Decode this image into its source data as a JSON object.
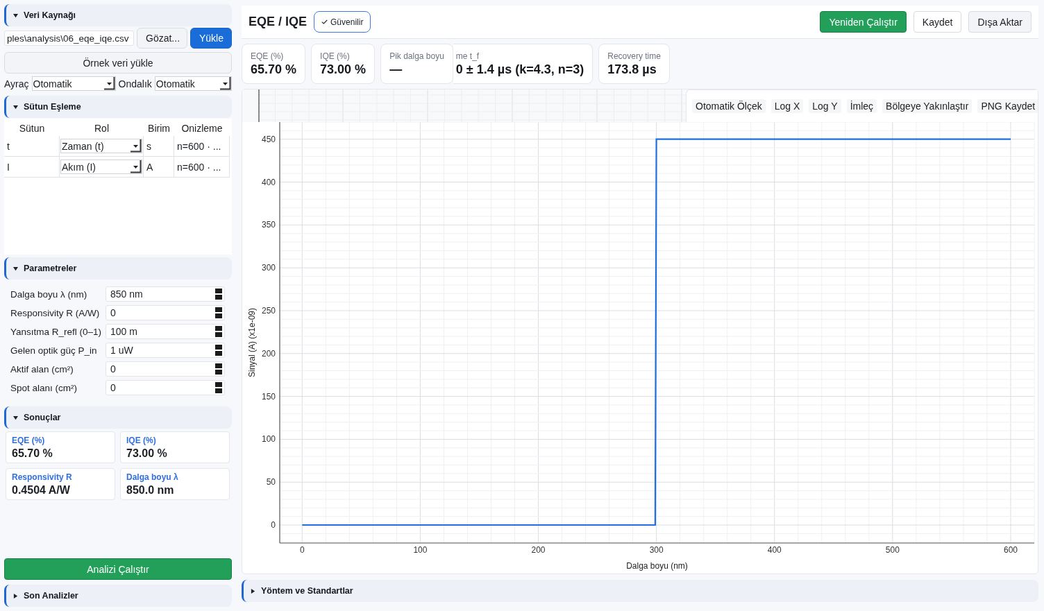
{
  "sidebar": {
    "data_source": {
      "title": "Veri Kaynağı",
      "expanded": true,
      "file_path": "ples\\analysis\\06_eqe_iqe.csv",
      "browse_button": "Gözat...",
      "load_button": "Yükle",
      "sample_button": "Örnek veri yükle",
      "delimiter": {
        "label": "Ayraç",
        "value": "Otomatik"
      },
      "decimal": {
        "label": "Ondalık",
        "value": "Otomatik"
      }
    },
    "column_mapping": {
      "title": "Sütun Eşleme",
      "expanded": true,
      "columns": [
        "Sütun",
        "Rol",
        "Birim",
        "Onizleme"
      ],
      "rows": [
        {
          "column": "t",
          "role": "Zaman (t)",
          "unit": "s",
          "preview": "n=600 · ..."
        },
        {
          "column": "I",
          "role": "Akım (I)",
          "unit": "A",
          "preview": "n=600 · ..."
        }
      ]
    },
    "parameters": {
      "title": "Parametreler",
      "expanded": true,
      "fields": [
        {
          "label": "Dalga boyu λ (nm)",
          "value": "850 nm"
        },
        {
          "label": "Responsivity R (A/W)",
          "value": "0"
        },
        {
          "label": "Yansıtma R_refl (0–1)",
          "value": "100 m"
        },
        {
          "label": "Gelen optik güç P_in",
          "value": "1 uW"
        },
        {
          "label": "Aktif alan (cm²)",
          "value": "0"
        },
        {
          "label": "Spot alanı (cm²)",
          "value": "0"
        }
      ]
    },
    "results": {
      "title": "Sonuçlar",
      "expanded": true,
      "cards": [
        {
          "label": "EQE (%)",
          "value": "65.70 %"
        },
        {
          "label": "IQE (%)",
          "value": "73.00 %"
        },
        {
          "label": "Responsivity R",
          "value": "0.4504 A/W"
        },
        {
          "label": "Dalga boyu λ",
          "value": "850.0 nm"
        }
      ]
    },
    "run_button": "Analizi Çalıştır",
    "recent": {
      "title": "Son Analizler",
      "expanded": false
    }
  },
  "main": {
    "title": "EQE / IQE",
    "badge": "Güvenilir",
    "buttons": [
      {
        "label": "Yeniden Çalıştır",
        "kind": "primary"
      },
      {
        "label": "Kaydet",
        "kind": "outline"
      },
      {
        "label": "Dışa Aktar",
        "kind": "secondary"
      }
    ],
    "stats": [
      {
        "label": "EQE (%)",
        "value": "65.70 %",
        "overlapped": false
      },
      {
        "label": "IQE (%)",
        "value": "73.00 %",
        "overlapped": false
      },
      {
        "label": "Pik dalga boyu",
        "value": "—",
        "overlapped": false
      },
      {
        "label": "me t_f",
        "value": "0 ± 1.4 µs (k=4.3, n=3)",
        "overlapped": true
      },
      {
        "label": "Recovery time",
        "value": "173.8 µs",
        "overlapped": false
      }
    ],
    "chart": {
      "toolbar": [
        "Otomatik Ölçek",
        "Log X",
        "Log Y",
        "İmleç",
        "Bölgeye Yakınlaştır",
        "PNG Kaydet"
      ],
      "chart_data": {
        "type": "line",
        "xlabel": "Dalga boyu (nm)",
        "ylabel": "Sinyal (A) (x1e-09)",
        "x": [
          0,
          100,
          200,
          299,
          300,
          400,
          500,
          600
        ],
        "series": [
          {
            "color": "#1f6fe0",
            "values": [
              0,
              0,
              0,
              0,
              450,
              450,
              450,
              450
            ]
          }
        ],
        "xlim": [
          -19,
          620
        ],
        "ylim": [
          -21,
          470
        ],
        "xticks": [
          0,
          100,
          200,
          300,
          400,
          500,
          600
        ],
        "yticks": [
          0,
          50,
          100,
          150,
          200,
          250,
          300,
          350,
          400,
          450
        ],
        "grid": true
      }
    },
    "methods": {
      "title": "Yöntem ve Standartlar",
      "expanded": false
    }
  }
}
